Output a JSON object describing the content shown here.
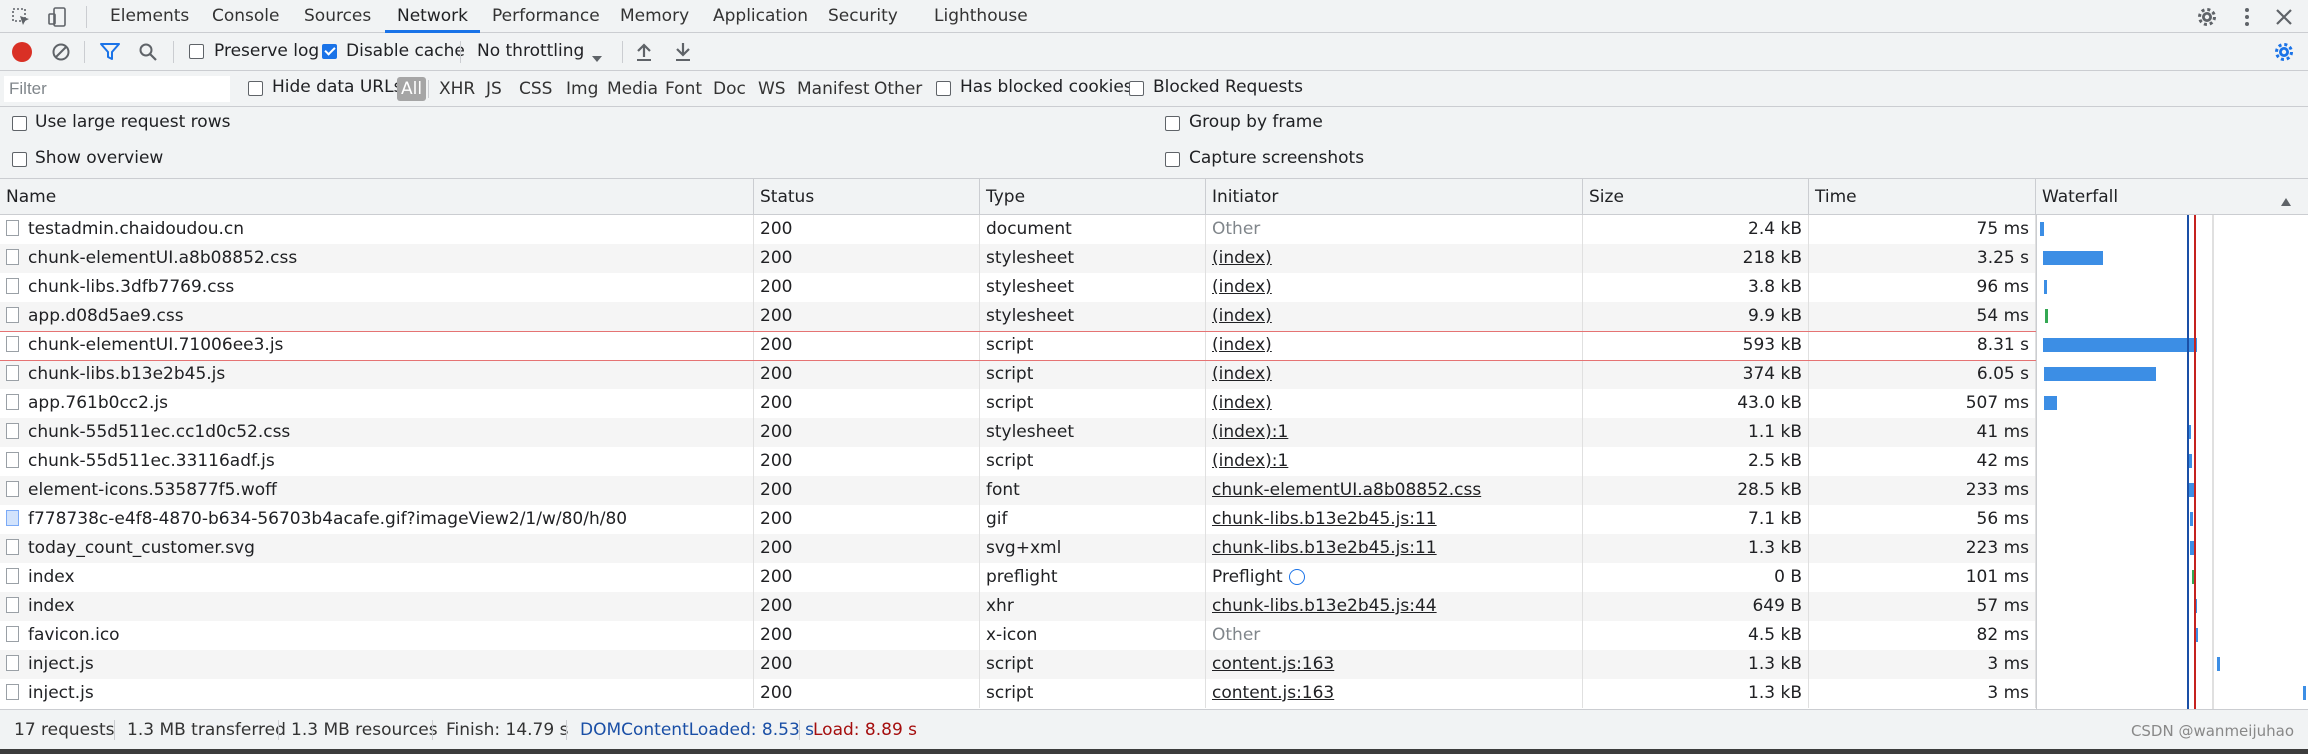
{
  "tabs": [
    "Elements",
    "Console",
    "Sources",
    "Network",
    "Performance",
    "Memory",
    "Application",
    "Security",
    "Lighthouse"
  ],
  "active_tab": "Network",
  "toolbar": {
    "preserve_log": "Preserve log",
    "disable_cache": "Disable cache",
    "throttling": "No throttling"
  },
  "filter": {
    "placeholder": "Filter",
    "hide_data_urls": "Hide data URLs",
    "types": [
      "All",
      "XHR",
      "JS",
      "CSS",
      "Img",
      "Media",
      "Font",
      "Doc",
      "WS",
      "Manifest",
      "Other"
    ],
    "has_blocked_cookies": "Has blocked cookies",
    "blocked_requests": "Blocked Requests"
  },
  "settings": {
    "large_rows": "Use large request rows",
    "show_overview": "Show overview",
    "group_by_frame": "Group by frame",
    "capture_screenshots": "Capture screenshots"
  },
  "columns": [
    "Name",
    "Status",
    "Type",
    "Initiator",
    "Size",
    "Time",
    "Waterfall"
  ],
  "rows": [
    {
      "name": "testadmin.chaidoudou.cn",
      "status": "200",
      "type": "document",
      "initiator": "Other",
      "size": "2.4 kB",
      "time": "75 ms",
      "icon": "file"
    },
    {
      "name": "chunk-elementUI.a8b08852.css",
      "status": "200",
      "type": "stylesheet",
      "initiator": "(index)",
      "size": "218 kB",
      "time": "3.25 s",
      "icon": "file"
    },
    {
      "name": "chunk-libs.3dfb7769.css",
      "status": "200",
      "type": "stylesheet",
      "initiator": "(index)",
      "size": "3.8 kB",
      "time": "96 ms",
      "icon": "file"
    },
    {
      "name": "app.d08d5ae9.css",
      "status": "200",
      "type": "stylesheet",
      "initiator": "(index)",
      "size": "9.9 kB",
      "time": "54 ms",
      "icon": "file"
    },
    {
      "name": "chunk-elementUI.71006ee3.js",
      "status": "200",
      "type": "script",
      "initiator": "(index)",
      "size": "593 kB",
      "time": "8.31 s",
      "icon": "file"
    },
    {
      "name": "chunk-libs.b13e2b45.js",
      "status": "200",
      "type": "script",
      "initiator": "(index)",
      "size": "374 kB",
      "time": "6.05 s",
      "icon": "file"
    },
    {
      "name": "app.761b0cc2.js",
      "status": "200",
      "type": "script",
      "initiator": "(index)",
      "size": "43.0 kB",
      "time": "507 ms",
      "icon": "file"
    },
    {
      "name": "chunk-55d511ec.cc1d0c52.css",
      "status": "200",
      "type": "stylesheet",
      "initiator": "(index):1",
      "size": "1.1 kB",
      "time": "41 ms",
      "icon": "file"
    },
    {
      "name": "chunk-55d511ec.33116adf.js",
      "status": "200",
      "type": "script",
      "initiator": "(index):1",
      "size": "2.5 kB",
      "time": "42 ms",
      "icon": "file"
    },
    {
      "name": "element-icons.535877f5.woff",
      "status": "200",
      "type": "font",
      "initiator": "chunk-elementUI.a8b08852.css",
      "size": "28.5 kB",
      "time": "233 ms",
      "icon": "file"
    },
    {
      "name": "f778738c-e4f8-4870-b634-56703b4acafe.gif?imageView2/1/w/80/h/80",
      "status": "200",
      "type": "gif",
      "initiator": "chunk-libs.b13e2b45.js:11",
      "size": "7.1 kB",
      "time": "56 ms",
      "icon": "image"
    },
    {
      "name": "today_count_customer.svg",
      "status": "200",
      "type": "svg+xml",
      "initiator": "chunk-libs.b13e2b45.js:11",
      "size": "1.3 kB",
      "time": "223 ms",
      "icon": "file"
    },
    {
      "name": "index",
      "status": "200",
      "type": "preflight",
      "initiator": "Preflight",
      "size": "0 B",
      "time": "101 ms",
      "icon": "file"
    },
    {
      "name": "index",
      "status": "200",
      "type": "xhr",
      "initiator": "chunk-libs.b13e2b45.js:44",
      "size": "649 B",
      "time": "57 ms",
      "icon": "file"
    },
    {
      "name": "favicon.ico",
      "status": "200",
      "type": "x-icon",
      "initiator": "Other",
      "size": "4.5 kB",
      "time": "82 ms",
      "icon": "file"
    },
    {
      "name": "inject.js",
      "status": "200",
      "type": "script",
      "initiator": "content.js:163",
      "size": "1.3 kB",
      "time": "3 ms",
      "icon": "file"
    },
    {
      "name": "inject.js",
      "status": "200",
      "type": "script",
      "initiator": "content.js:163",
      "size": "1.3 kB",
      "time": "3 ms",
      "icon": "file"
    }
  ],
  "status": {
    "requests": "17 requests",
    "transferred": "1.3 MB transferred",
    "resources": "1.3 MB resources",
    "finish": "Finish: 14.79 s",
    "dom": "DOMContentLoaded: 8.53 s",
    "load": "Load: 8.89 s"
  },
  "watermark": "CSDN @wanmeijuhao",
  "colors": {
    "accent": "#1a73e8",
    "dom_line": "#1a4fa6",
    "load_line": "#c5221f",
    "record": "#d93025",
    "bar": "#3c8ee5"
  }
}
